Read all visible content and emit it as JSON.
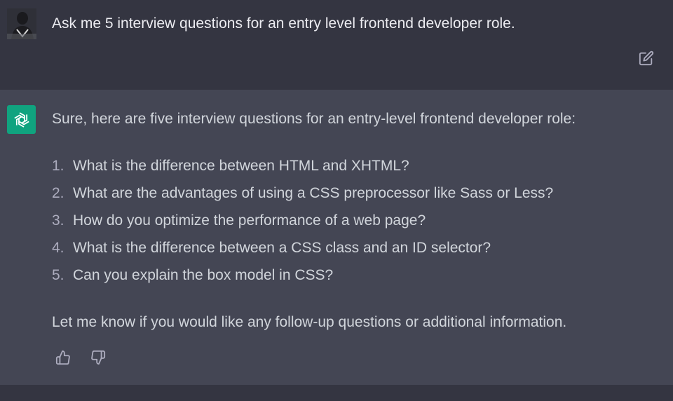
{
  "user_message": {
    "text": "Ask me 5 interview questions for an entry level frontend developer role."
  },
  "assistant_message": {
    "intro": "Sure, here are five interview questions for an entry-level frontend developer role:",
    "questions": [
      {
        "number": "1.",
        "text": "What is the difference between HTML and XHTML?"
      },
      {
        "number": "2.",
        "text": "What are the advantages of using a CSS preprocessor like Sass or Less?"
      },
      {
        "number": "3.",
        "text": "How do you optimize the performance of a web page?"
      },
      {
        "number": "4.",
        "text": "What is the difference between a CSS class and an ID selector?"
      },
      {
        "number": "5.",
        "text": "Can you explain the box model in CSS?"
      }
    ],
    "outro": "Let me know if you would like any follow-up questions or additional information."
  },
  "icons": {
    "edit": "edit-icon",
    "thumbs_up": "thumbs-up-icon",
    "thumbs_down": "thumbs-down-icon",
    "assistant_logo": "openai-logo-icon"
  },
  "colors": {
    "user_bg": "#343541",
    "assistant_bg": "#444654",
    "logo_bg": "#10a37f",
    "text": "#d1d5db"
  }
}
